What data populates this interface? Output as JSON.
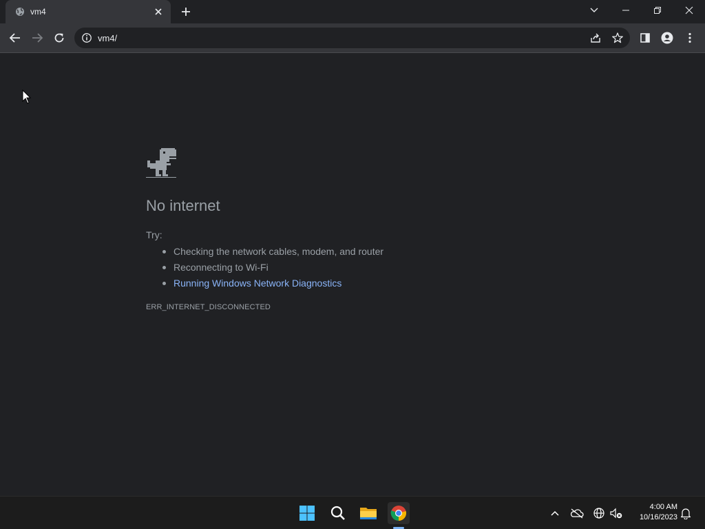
{
  "browser": {
    "tab": {
      "title": "vm4",
      "favicon": "globe-icon"
    },
    "address_bar": {
      "url": "vm4/"
    },
    "colors": {
      "frame": "#202124",
      "toolbar": "#35363a",
      "link": "#8ab4f8"
    }
  },
  "error_page": {
    "icon": "dino-icon",
    "headline": "No internet",
    "try_label": "Try:",
    "suggestions": [
      "Checking the network cables, modem, and router",
      "Reconnecting to Wi-Fi",
      "Running Windows Network Diagnostics"
    ],
    "error_code": "ERR_INTERNET_DISCONNECTED"
  },
  "taskbar": {
    "pinned": [
      "windows-start-icon",
      "search-icon",
      "file-explorer-icon",
      "chrome-icon"
    ],
    "tray": [
      "chevron-up-icon",
      "onedrive-offline-icon",
      "network-globe-icon",
      "volume-muted-icon",
      "notification-bell-icon"
    ],
    "time": "4:00 AM",
    "date": "10/16/2023"
  }
}
